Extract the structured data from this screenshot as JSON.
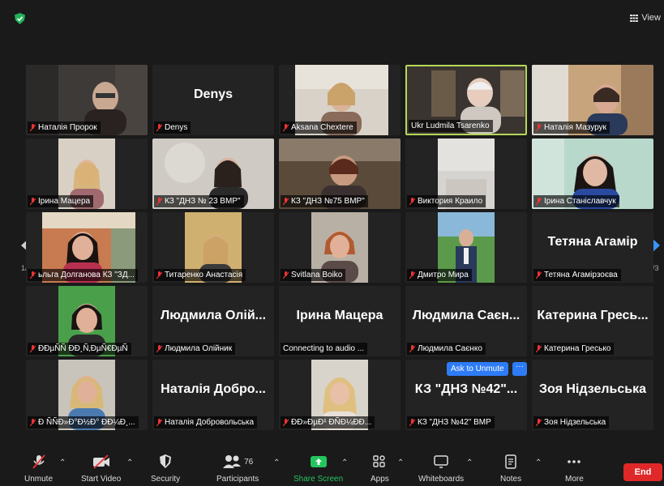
{
  "header": {
    "view_label": "View"
  },
  "pagination": {
    "left": "1/3",
    "right": "1/3"
  },
  "tiles": [
    {
      "label": "Наталія Пророк"
    },
    {
      "label": "Denys",
      "big": "Denys"
    },
    {
      "label": "Aksana Chextere"
    },
    {
      "label": "Ukr Ludmila Tsarenko"
    },
    {
      "label": "Наталія Мазурук"
    },
    {
      "label": "Ірина Мацера"
    },
    {
      "label": "КЗ \"ДНЗ № 23 ВМР\""
    },
    {
      "label": "КЗ \"ДНЗ №75 ВМР\""
    },
    {
      "label": "Виктория Краило"
    },
    {
      "label": "Ірина Станіславчук"
    },
    {
      "label": "ьльга Долганова КЗ \"ЗД..."
    },
    {
      "label": "Титаренко Анастасія"
    },
    {
      "label": "Svitlana Boiko"
    },
    {
      "label": "Дмитро Мира"
    },
    {
      "label": "Тетяна Агамірзоєва",
      "big": "Тетяна Агамір"
    },
    {
      "label": "ÐÐµÑÑ ÐÐ¸Ñ‚ÐµÑ€ÐµÑ"
    },
    {
      "label": "Людмила Олійник",
      "big": "Людмила Олій..."
    },
    {
      "label": "Connecting to audio ...",
      "big": "Ірина Мацера"
    },
    {
      "label": "Людмила Саєнко",
      "big": "Людмила Саєн..."
    },
    {
      "label": "Катерина Гресько",
      "big": "Катерина Гресь..."
    },
    {
      "label": "Ð ÑÑÐ»Ð°Ð½Ð° ÐÐ¼Ð¸..."
    },
    {
      "label": "Наталія Добровольська",
      "big": "Наталія Добро..."
    },
    {
      "label": "ÐÐ»ÐµÐ¹ ÐÑÐ¼ÐÐ..."
    },
    {
      "label": "КЗ \"ДНЗ №42\" ВМР",
      "big": "КЗ \"ДНЗ №42\"..."
    },
    {
      "label": "Зоя Нідзельська",
      "big": "Зоя Нідзельська"
    }
  ],
  "ask_unmute": {
    "label": "Ask to Unmute",
    "more": "···"
  },
  "toolbar": {
    "unmute": "Unmute",
    "start_video": "Start Video",
    "security": "Security",
    "participants": "Participants",
    "participants_count": "76",
    "share_screen": "Share Screen",
    "apps": "Apps",
    "whiteboards": "Whiteboards",
    "notes": "Notes",
    "more": "More",
    "end": "End"
  },
  "colors": {
    "active_speaker": "#b5d85a",
    "share_green": "#23c55e",
    "end_red": "#e02828",
    "unmute_blue": "#2d7cf6"
  }
}
